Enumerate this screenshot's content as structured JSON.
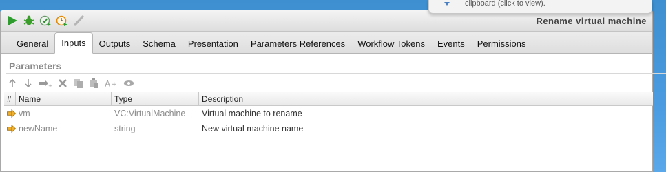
{
  "window": {
    "title": "Rename virtual machine"
  },
  "toolbar": {
    "icons": [
      "run-icon",
      "debug-icon",
      "validate-icon",
      "schedule-icon",
      "edit-icon"
    ]
  },
  "tabs": [
    {
      "label": "General",
      "active": false
    },
    {
      "label": "Inputs",
      "active": true
    },
    {
      "label": "Outputs",
      "active": false
    },
    {
      "label": "Schema",
      "active": false
    },
    {
      "label": "Presentation",
      "active": false
    },
    {
      "label": "Parameters References",
      "active": false
    },
    {
      "label": "Workflow Tokens",
      "active": false
    },
    {
      "label": "Events",
      "active": false
    },
    {
      "label": "Permissions",
      "active": false
    }
  ],
  "parameters": {
    "title": "Parameters",
    "toolbar_icons": [
      "move-up-icon",
      "move-down-icon",
      "insert-parameter-icon",
      "delete-icon",
      "copy-icon",
      "paste-icon",
      "rename-icon",
      "view-icon"
    ],
    "columns": [
      "#",
      "Name",
      "Type",
      "Description"
    ],
    "rows": [
      {
        "name": "vm",
        "type": "VC:VirtualMachine",
        "description": "Virtual machine to rename"
      },
      {
        "name": "newName",
        "type": "string",
        "description": "New virtual machine name"
      }
    ]
  },
  "notification": {
    "text": "clipboard (click to view)."
  },
  "colors": {
    "desktop_blue": "#4a9be0",
    "run_green": "#2e9b2e",
    "arrow_orange": "#e8a317",
    "muted_text": "#8b8b8b"
  }
}
